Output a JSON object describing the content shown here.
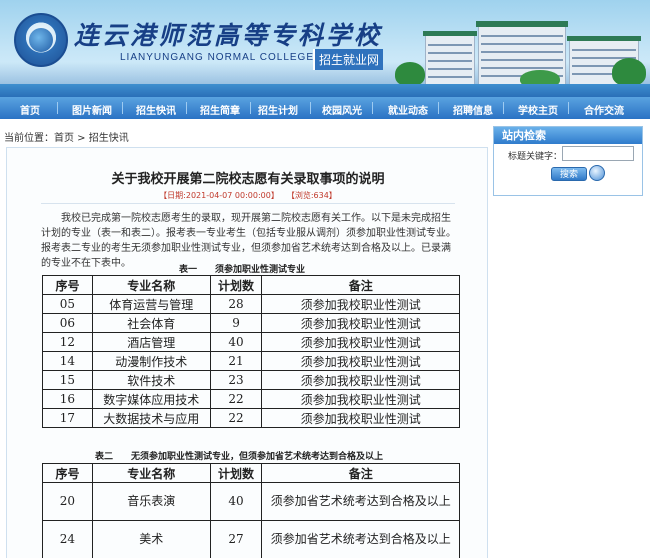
{
  "header": {
    "school_name_cn": "连云港师范高等专科学校",
    "school_name_en": "LIANYUNGANG NORMAL COLLEGE",
    "site_name": "招生就业网"
  },
  "nav": {
    "items": [
      "首页",
      "图片新闻",
      "招生快讯",
      "招生简章",
      "招生计划",
      "校园风光",
      "就业动态",
      "招聘信息",
      "学校主页",
      "合作交流"
    ]
  },
  "breadcrumb": {
    "prefix": "当前位置：",
    "home": "首页",
    "sep": " > ",
    "current": "招生快讯"
  },
  "article": {
    "title": "关于我校开展第二院校志愿有关录取事项的说明",
    "date": "【日期:2021-04-07 00:00:00】",
    "views": "【浏览:634】",
    "paragraph": "我校已完成第一院校志愿考生的录取，现开展第二院校志愿有关工作。以下是未完成招生计划的专业（表一和表二）。报考表一专业考生（包括专业服从调剂）须参加职业性测试专业。报考表二专业的考生无须参加职业性测试专业，但须参加省艺术统考达到合格及以上。已录满的专业不在下表中。"
  },
  "table1": {
    "caption": "表一　　须参加职业性测试专业",
    "headers": [
      "序号",
      "专业名称",
      "计划数",
      "备注"
    ],
    "rows": [
      [
        "05",
        "体育运营与管理",
        "28",
        "须参加我校职业性测试"
      ],
      [
        "06",
        "社会体育",
        "9",
        "须参加我校职业性测试"
      ],
      [
        "12",
        "酒店管理",
        "40",
        "须参加我校职业性测试"
      ],
      [
        "14",
        "动漫制作技术",
        "21",
        "须参加我校职业性测试"
      ],
      [
        "15",
        "软件技术",
        "23",
        "须参加我校职业性测试"
      ],
      [
        "16",
        "数字媒体应用技术",
        "22",
        "须参加我校职业性测试"
      ],
      [
        "17",
        "大数据技术与应用",
        "22",
        "须参加我校职业性测试"
      ]
    ]
  },
  "table2": {
    "caption": "表二　　无须参加职业性测试专业，但须参加省艺术统考达到合格及以上",
    "headers": [
      "序号",
      "专业名称",
      "计划数",
      "备注"
    ],
    "rows": [
      [
        "20",
        "音乐表演",
        "40",
        "须参加省艺术统考达到合格及以上"
      ],
      [
        "24",
        "美术",
        "27",
        "须参加省艺术统考达到合格及以上"
      ]
    ]
  },
  "sidebar": {
    "title": "站内检索",
    "label": "标题关键字：",
    "input_value": "",
    "button": "搜索"
  },
  "colors": {
    "nav_bg": "#2a72c4",
    "accent": "#2f7bcc",
    "meta_red": "#c0392b"
  }
}
